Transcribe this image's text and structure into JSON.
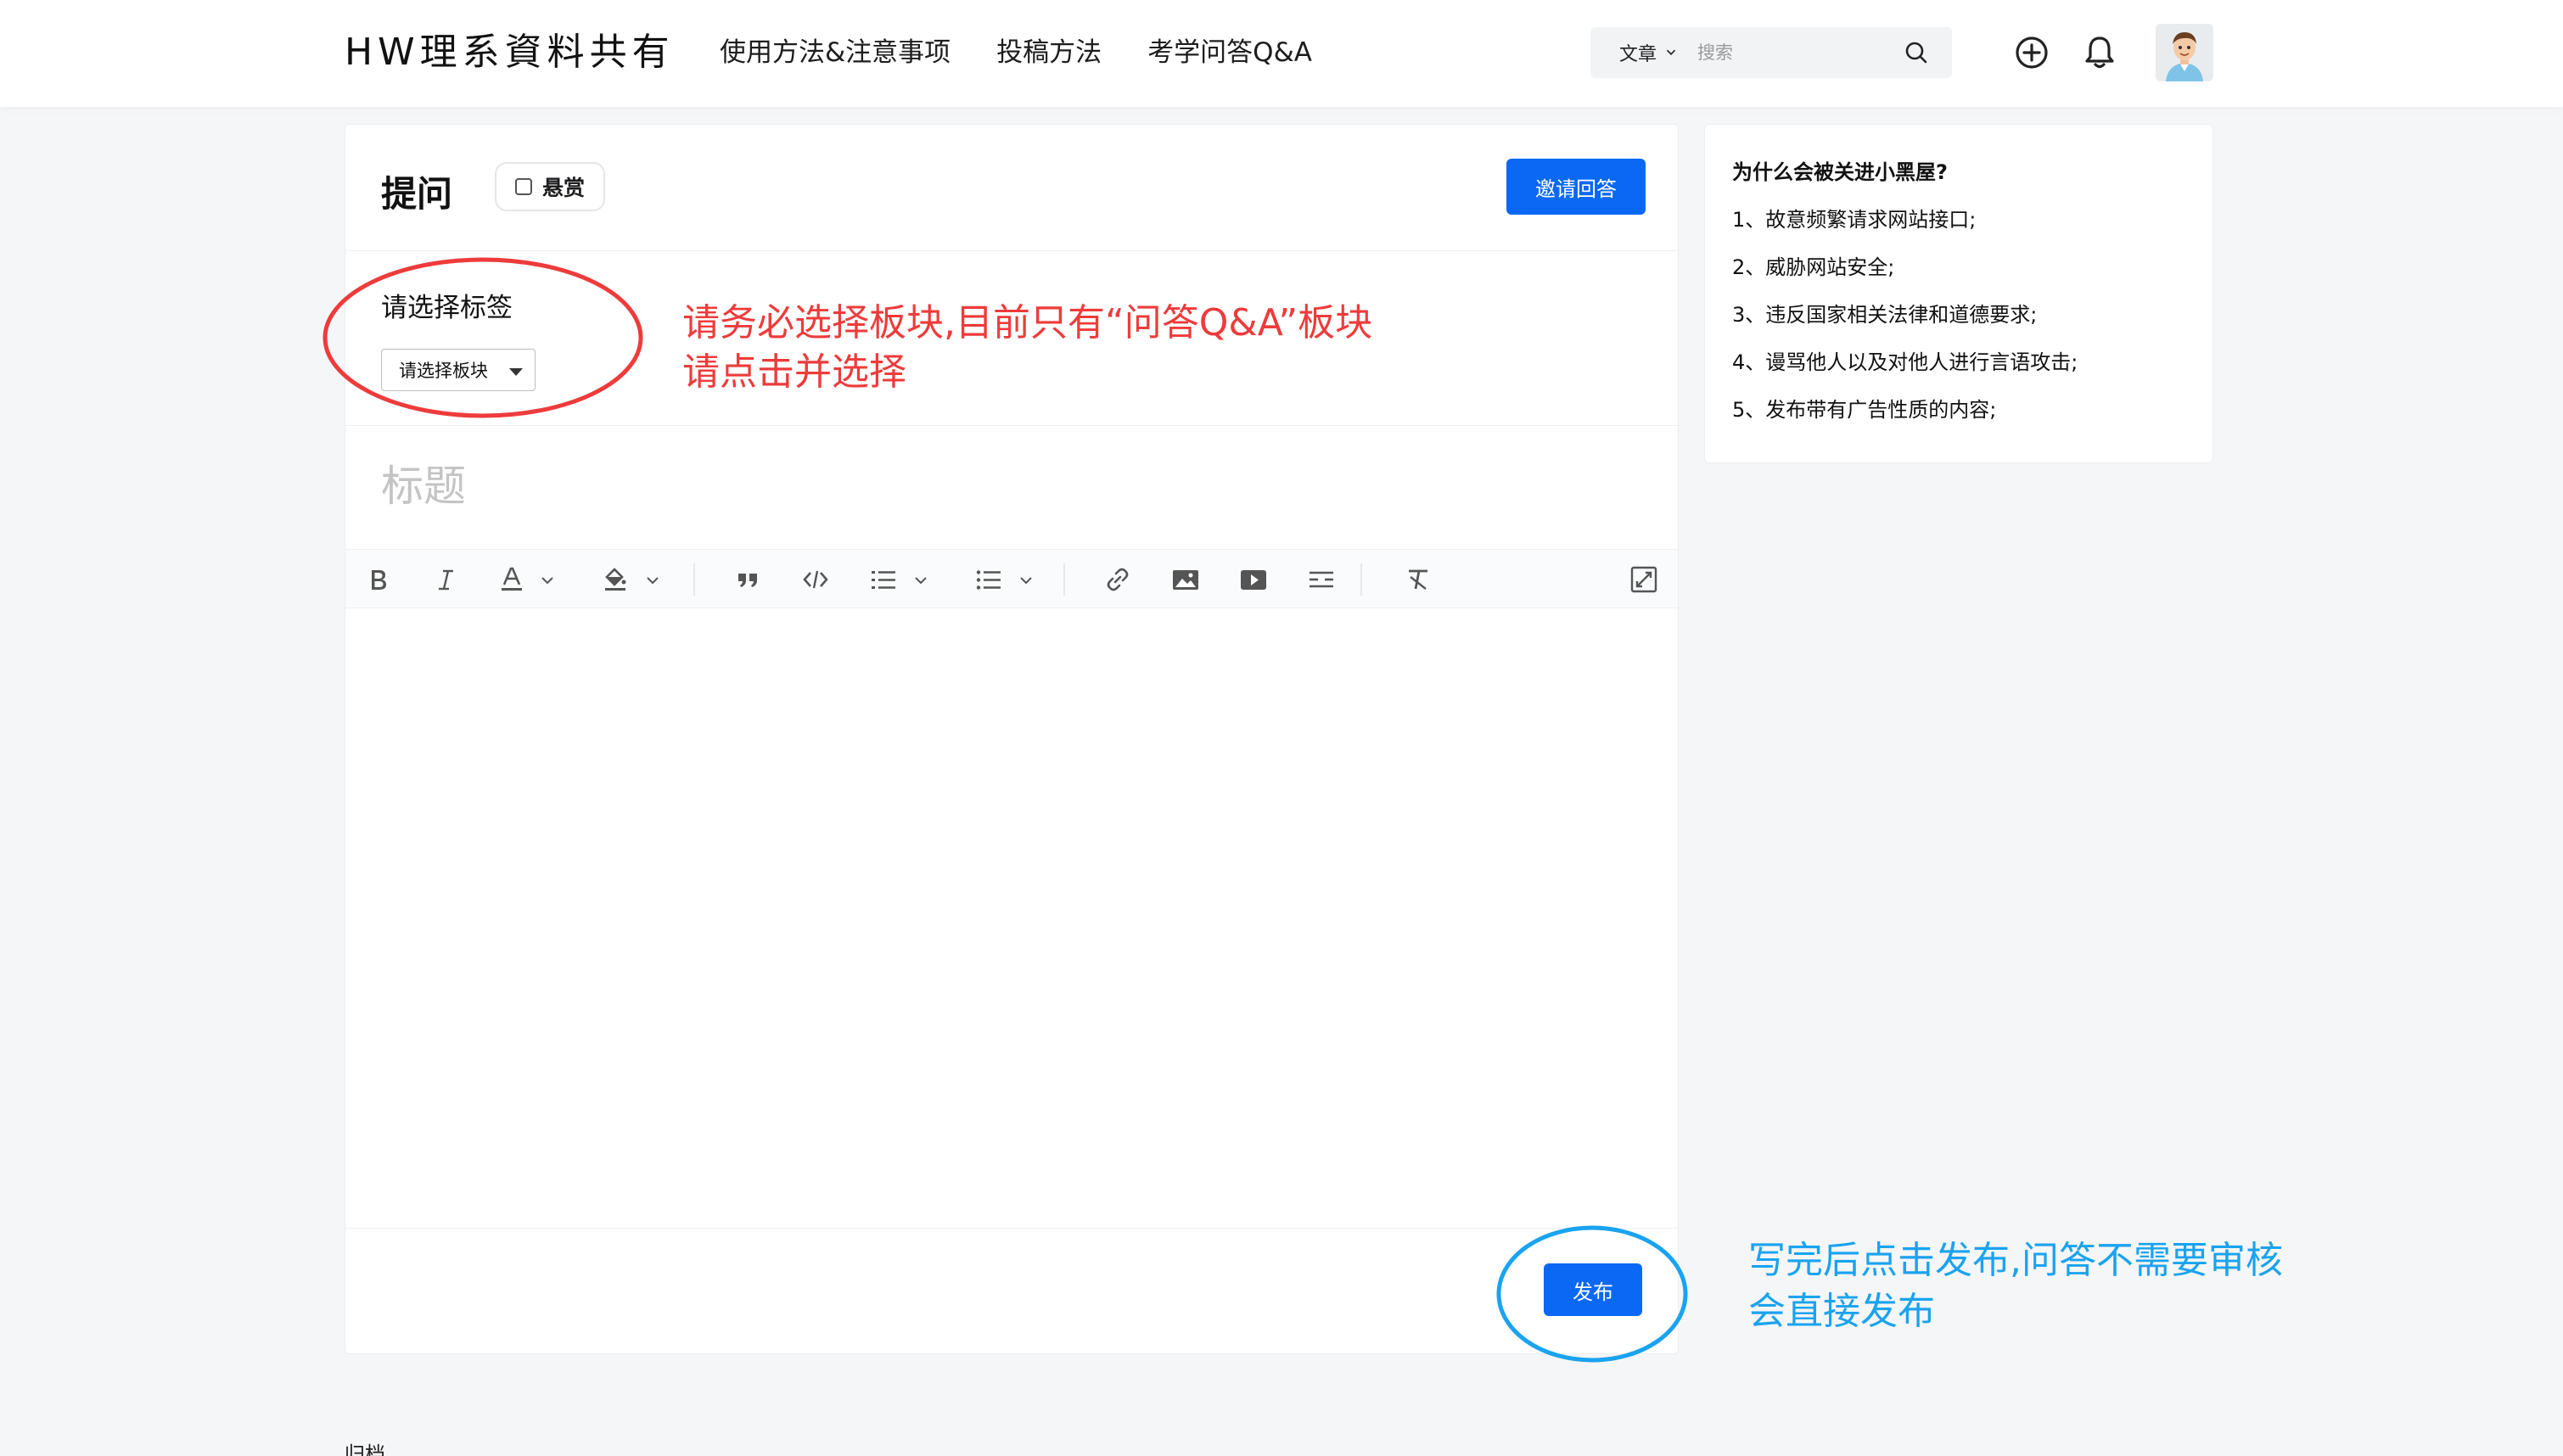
{
  "header": {
    "logo": "HW理系資料共有",
    "nav": [
      "使用方法&注意事项",
      "投稿方法",
      "考学问答Q&A"
    ],
    "search": {
      "type_label": "文章",
      "placeholder": "搜索"
    }
  },
  "question_form": {
    "title": "提问",
    "bounty_label": "悬赏",
    "invite_label": "邀请回答",
    "tag_label": "请选择标签",
    "tag_select_value": "请选择板块",
    "title_placeholder": "标题",
    "publish_label": "发布",
    "toolbar": [
      "bold",
      "italic",
      "font-color",
      "background-color",
      "quote",
      "code",
      "ordered-list",
      "bullet-list",
      "link",
      "image",
      "video",
      "divider",
      "clear-format",
      "fullscreen"
    ]
  },
  "sidebar": {
    "title": "为什么会被关进小黑屋?",
    "rules": [
      "1、故意频繁请求网站接口;",
      "2、威胁网站安全;",
      "3、违反国家相关法律和道德要求;",
      "4、谩骂他人以及对他人进行言语攻击;",
      "5、发布带有广告性质的内容;"
    ]
  },
  "annotations": {
    "red_line1": "请务必选择板块,目前只有“问答Q&A”板块",
    "red_line2": "请点击并选择",
    "blue_line1": "写完后点击发布,问答不需要审核",
    "blue_line2": "会直接发布",
    "red_color": "#ee3b3b",
    "blue_color": "#1aa3ef"
  },
  "footer": {
    "label": "归档"
  },
  "colors": {
    "primary": "#0a68f5",
    "background": "#f5f6f7"
  }
}
